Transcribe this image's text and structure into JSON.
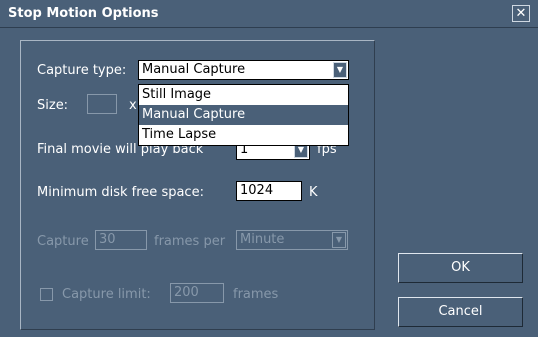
{
  "window": {
    "title": "Stop Motion Options",
    "close_glyph": "✕"
  },
  "form": {
    "capture_type_label": "Capture type:",
    "capture_type_value": "Manual Capture",
    "capture_type_options": [
      "Still Image",
      "Manual Capture",
      "Time Lapse"
    ],
    "size_label": "Size:",
    "size_x": "x",
    "final_movie_label": "Final movie will play back",
    "final_movie_value": "1",
    "fps_label": "fps",
    "min_disk_label": "Minimum disk free space:",
    "min_disk_value": "1024",
    "min_disk_unit": "K",
    "capture_label": "Capture",
    "capture_value": "30",
    "frames_per_label": "frames per",
    "frames_per_value": "Minute",
    "capture_limit_label": "Capture limit:",
    "capture_limit_value": "200",
    "capture_limit_unit": "frames"
  },
  "buttons": {
    "ok": "OK",
    "cancel": "Cancel"
  },
  "icons": {
    "dropdown_arrow": "▼"
  }
}
